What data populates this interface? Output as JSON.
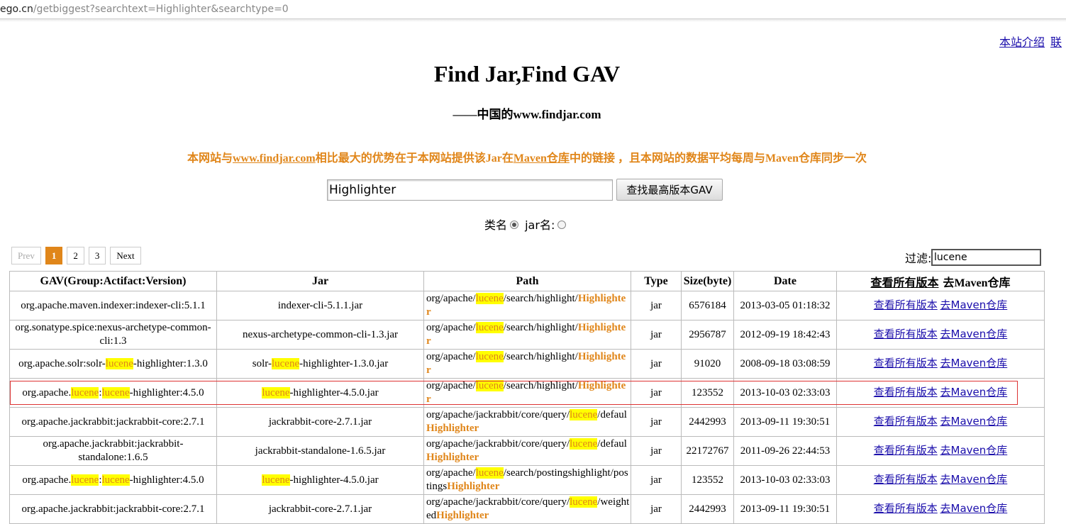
{
  "browser": {
    "url_host": "ego.cn",
    "url_path": "/getbiggest?searchtext=Highlighter&searchtype=0"
  },
  "top_links": [
    "本站介绍",
    "联"
  ],
  "header": {
    "title": "Find Jar,Find GAV",
    "subtitle": "——中国的www.findjar.com"
  },
  "notice": {
    "before": "本网站与",
    "link1": "www.findjar.com",
    "middle": "相比最大的优势在于本网站提供该Jar在",
    "link2": "Maven仓库",
    "after": "中的链接 ，且本网站的数据平均每周与Maven仓库同步一次"
  },
  "search": {
    "value": "Highlighter",
    "button_label": "查找最高版本GAV",
    "radio_classname_label": "类名",
    "radio_jarname_label": "jar名:",
    "selected": "classname"
  },
  "pager": {
    "prev": "Prev",
    "pages": [
      "1",
      "2",
      "3"
    ],
    "current": "1",
    "next": "Next"
  },
  "filter": {
    "label": "过滤:",
    "value": "lucene"
  },
  "table": {
    "headers": [
      "GAV(Group:Actifact:Version)",
      "Jar",
      "Path",
      "Type",
      "Size(byte)",
      "Date"
    ],
    "header_link_all": "查看所有版本",
    "header_link_maven": "去Maven仓库",
    "link_all_label": "查看所有版本",
    "link_maven_label": "去Maven仓库",
    "highlight_term": "lucene",
    "rows": [
      {
        "gav": [
          "org.apache.maven.indexer:indexer-cli:5.1.1"
        ],
        "jar": [
          "indexer-cli-5.1.1.jar"
        ],
        "path": [
          "org/apache/",
          "lucene",
          "/search/highlight/"
        ],
        "name": "Highlighter",
        "type": "jar",
        "size": "6576184",
        "date": "2013-03-05 01:18:32"
      },
      {
        "gav": [
          "org.sonatype.spice:nexus-archetype-common-cli:1.3"
        ],
        "jar": [
          "nexus-archetype-common-cli-1.3.jar"
        ],
        "path": [
          "org/apache/",
          "lucene",
          "/search/highlight/"
        ],
        "name": "Highlighter",
        "type": "jar",
        "size": "2956787",
        "date": "2012-09-19 18:42:43"
      },
      {
        "gav": [
          "org.apache.solr:solr-",
          "lucene",
          "-highlighter:1.3.0"
        ],
        "jar": [
          "solr-",
          "lucene",
          "-highlighter-1.3.0.jar"
        ],
        "path": [
          "org/apache/",
          "lucene",
          "/search/highlight/"
        ],
        "name": "Highlighter",
        "type": "jar",
        "size": "91020",
        "date": "2008-09-18 03:08:59"
      },
      {
        "gav": [
          "org.apache.",
          "lucene",
          ":",
          "lucene",
          "-highlighter:4.5.0"
        ],
        "jar": [
          "",
          "lucene",
          "-highlighter-4.5.0.jar"
        ],
        "path": [
          "org/apache/",
          "lucene",
          "/search/highlight/"
        ],
        "name": "Highlighter",
        "type": "jar",
        "size": "123552",
        "date": "2013-10-03 02:33:03"
      },
      {
        "gav": [
          "org.apache.jackrabbit:jackrabbit-core:2.7.1"
        ],
        "jar": [
          "jackrabbit-core-2.7.1.jar"
        ],
        "path": [
          "org/apache/jackrabbit/core/query/",
          "lucene",
          "/defaul"
        ],
        "name": "Highlighter",
        "type": "jar",
        "size": "2442993",
        "date": "2013-09-11 19:30:51"
      },
      {
        "gav": [
          "org.apache.jackrabbit:jackrabbit-standalone:1.6.5"
        ],
        "jar": [
          "jackrabbit-standalone-1.6.5.jar"
        ],
        "path": [
          "org/apache/jackrabbit/core/query/",
          "lucene",
          "/defaul"
        ],
        "name": "Highlighter",
        "type": "jar",
        "size": "22172767",
        "date": "2011-09-26 22:44:53"
      },
      {
        "gav": [
          "org.apache.",
          "lucene",
          ":",
          "lucene",
          "-highlighter:4.5.0"
        ],
        "jar": [
          "",
          "lucene",
          "-highlighter-4.5.0.jar"
        ],
        "path": [
          "org/apache/",
          "lucene",
          "/search/postingshighlight/postings"
        ],
        "name": "Highlighter",
        "type": "jar",
        "size": "123552",
        "date": "2013-10-03 02:33:03"
      },
      {
        "gav": [
          "org.apache.jackrabbit:jackrabbit-core:2.7.1"
        ],
        "jar": [
          "jackrabbit-core-2.7.1.jar"
        ],
        "path": [
          "org/apache/jackrabbit/core/query/",
          "lucene",
          "/weighted"
        ],
        "name": "Highlighter",
        "type": "jar",
        "size": "2442993",
        "date": "2013-09-11 19:30:51"
      }
    ]
  }
}
